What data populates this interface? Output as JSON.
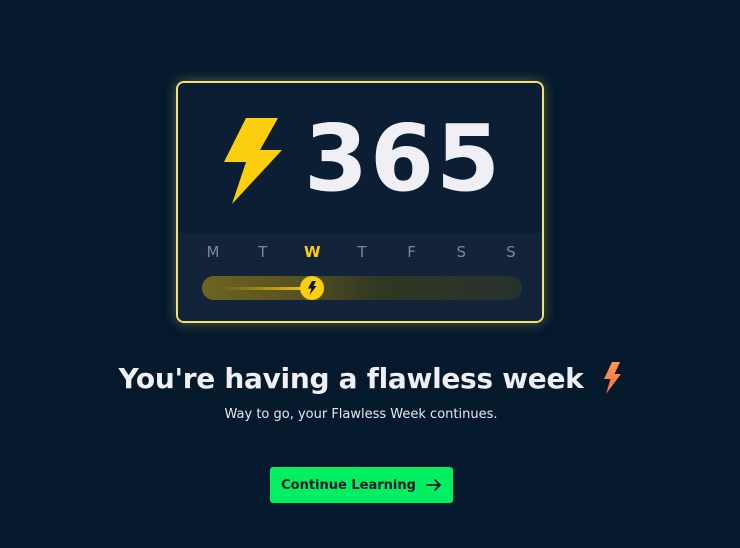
{
  "streak": {
    "count": "365",
    "icon": "lightning-bolt-icon",
    "color": "#fcce0d"
  },
  "week": {
    "days": [
      {
        "label": "M",
        "active": false
      },
      {
        "label": "T",
        "active": false
      },
      {
        "label": "W",
        "active": true
      },
      {
        "label": "T",
        "active": false
      },
      {
        "label": "F",
        "active": false
      },
      {
        "label": "S",
        "active": false
      },
      {
        "label": "S",
        "active": false
      }
    ],
    "progress_day_index": 2
  },
  "message": {
    "headline": "You're having a flawless week",
    "headline_icon": "orange-lightning-icon",
    "subtitle": "Way to go, your Flawless Week continues."
  },
  "cta": {
    "label": "Continue Learning",
    "icon": "arrow-right-icon",
    "background": "#03ef62"
  },
  "colors": {
    "background": "#05192d",
    "card_border": "#efe46c",
    "accent_yellow": "#fcce0d",
    "accent_orange": "#ff7b48"
  }
}
